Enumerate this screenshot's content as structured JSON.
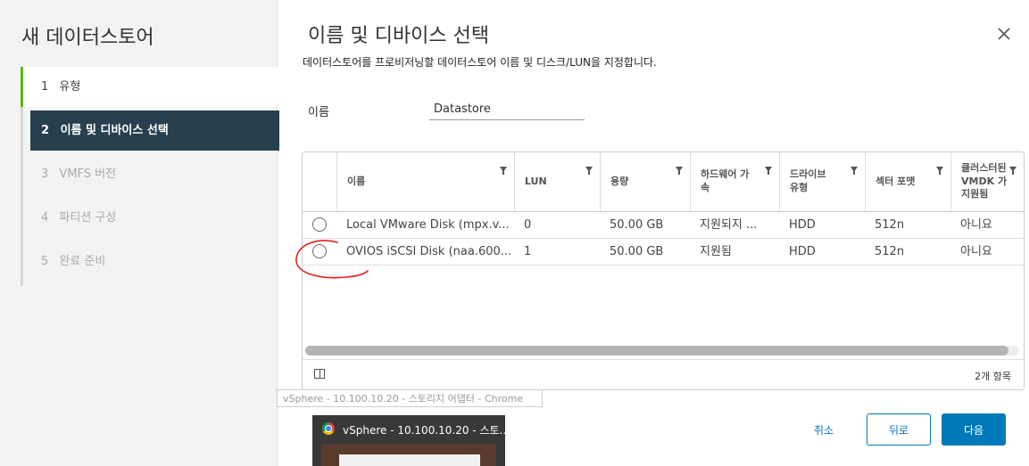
{
  "wizard": {
    "title": "새 데이터스토어",
    "steps": [
      {
        "num": "1",
        "label": "유형",
        "state": "done"
      },
      {
        "num": "2",
        "label": "이름 및 디바이스 선택",
        "state": "active"
      },
      {
        "num": "3",
        "label": "VMFS 버전",
        "state": "future"
      },
      {
        "num": "4",
        "label": "파티션 구성",
        "state": "future"
      },
      {
        "num": "5",
        "label": "완료 준비",
        "state": "future"
      }
    ]
  },
  "main": {
    "title": "이름 및 디바이스 선택",
    "description": "데이터스토어를 프로비저닝할 데이터스토어 이름 및 디스크/LUN을 지정합니다.",
    "name_label": "이름",
    "name_value": "Datastore",
    "close_icon": "close-icon"
  },
  "grid": {
    "columns": [
      {
        "label": "이름"
      },
      {
        "label": "LUN"
      },
      {
        "label": "용량"
      },
      {
        "label": "하드웨어 가속"
      },
      {
        "label": "드라이브 유형"
      },
      {
        "label": "섹터 포맷"
      },
      {
        "label": "클러스터된 VMDK 가 지원됨"
      }
    ],
    "rows": [
      {
        "name": "Local VMware Disk (mpx.v...",
        "lun": "0",
        "capacity": "50.00 GB",
        "hw": "지원되지 ...",
        "drive": "HDD",
        "sector": "512n",
        "cluster": "아니요",
        "selected": false
      },
      {
        "name": "OVIOS iSCSI Disk (naa.600...",
        "lun": "1",
        "capacity": "50.00 GB",
        "hw": "지원됨",
        "drive": "HDD",
        "sector": "512n",
        "cluster": "아니요",
        "selected": false
      }
    ],
    "item_count": "2개 항목"
  },
  "tooltip": "vSphere - 10.100.10.20 - 스토리지 어댑터 - Chrome",
  "taskbar": {
    "title": "vSphere - 10.100.10.20 - 스토..."
  },
  "footer": {
    "cancel": "취소",
    "back": "뒤로",
    "next": "다음"
  },
  "colors": {
    "accent": "#0079b8",
    "active_step_bg": "#27404f",
    "done_step": "#60b515",
    "annotation": "#e0201c"
  }
}
